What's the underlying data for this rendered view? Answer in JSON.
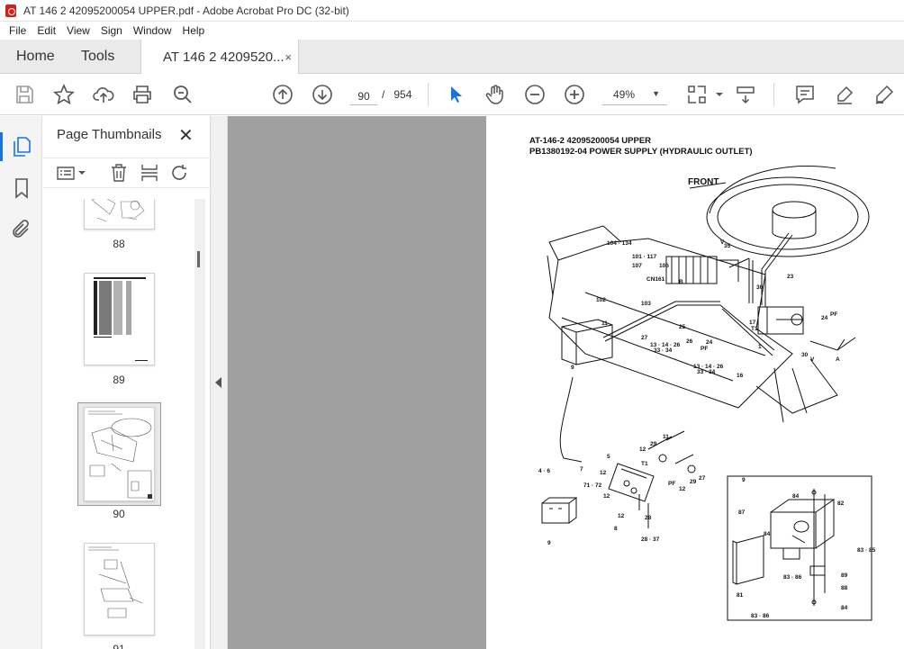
{
  "window": {
    "title": "AT 146 2 42095200054 UPPER.pdf - Adobe Acrobat Pro DC (32-bit)"
  },
  "menu": [
    "File",
    "Edit",
    "View",
    "Sign",
    "Window",
    "Help"
  ],
  "tabs": {
    "home": "Home",
    "tools": "Tools",
    "document": "AT 146 2 4209520...",
    "close": "×"
  },
  "toolbar": {
    "current_page": "90",
    "page_separator": "/",
    "total_pages": "954",
    "zoom": "49%"
  },
  "panel": {
    "title": "Page Thumbnails",
    "close": "✕",
    "thumbnails": [
      {
        "label": "88"
      },
      {
        "label": "89"
      },
      {
        "label": "90",
        "selected": true
      },
      {
        "label": "91"
      }
    ]
  },
  "document_page": {
    "header_line1": "AT-146-2 42095200054 UPPER",
    "header_line2": "PB1380192-04 POWER SUPPLY (HYDRAULIC OUTLET)",
    "front_label": "FRONT",
    "labels": {
      "l104": "104 · 134",
      "l101": "101 · 117",
      "l107": "107",
      "l106": "106",
      "lb": "B",
      "lcn": "CN161",
      "l102": "102",
      "l103": "103",
      "l11a": "11",
      "l27": "27",
      "l13": "13 · 14 · 26",
      "l33": "33 · 34",
      "l25": "25",
      "l26": "26",
      "lpf": "PF",
      "l24a": "24",
      "l17": "17",
      "lt1": "T1",
      "l1": "1",
      "l13b": "13 · 14 · 26",
      "l33b": "33 · 34",
      "l16": "16",
      "l35": "35",
      "lv": "V",
      "l23": "23",
      "l30": "30",
      "l24": "24",
      "lpf2": "PF",
      "l30b": "30",
      "lv2": "V",
      "la": "A",
      "l9": "9",
      "l46": "4 · 6",
      "l7": "7",
      "l7172": "71 · 72",
      "l5": "5",
      "l12a": "12",
      "l12b": "12",
      "l12c": "12",
      "l8": "8",
      "l9b": "9",
      "l29": "29",
      "l12d": "12",
      "l11": "11",
      "lt1b": "T1",
      "lpf3": "PF",
      "l12e": "12",
      "l29b": "29",
      "l27b": "27",
      "l28": "28",
      "l2837": "28 · 37",
      "l9c": "9",
      "l84": "84",
      "l82": "82",
      "l87": "87",
      "l84b": "84",
      "l8385": "83 · 85",
      "l8386": "83 · 86",
      "l89": "89",
      "l81": "81",
      "l88": "88",
      "l84c": "84",
      "l8386b": "83 · 86"
    }
  },
  "colors": {
    "accent": "#1473e6",
    "viewport_bg": "#a0a0a0",
    "acrobat_red": "#d6201c"
  }
}
